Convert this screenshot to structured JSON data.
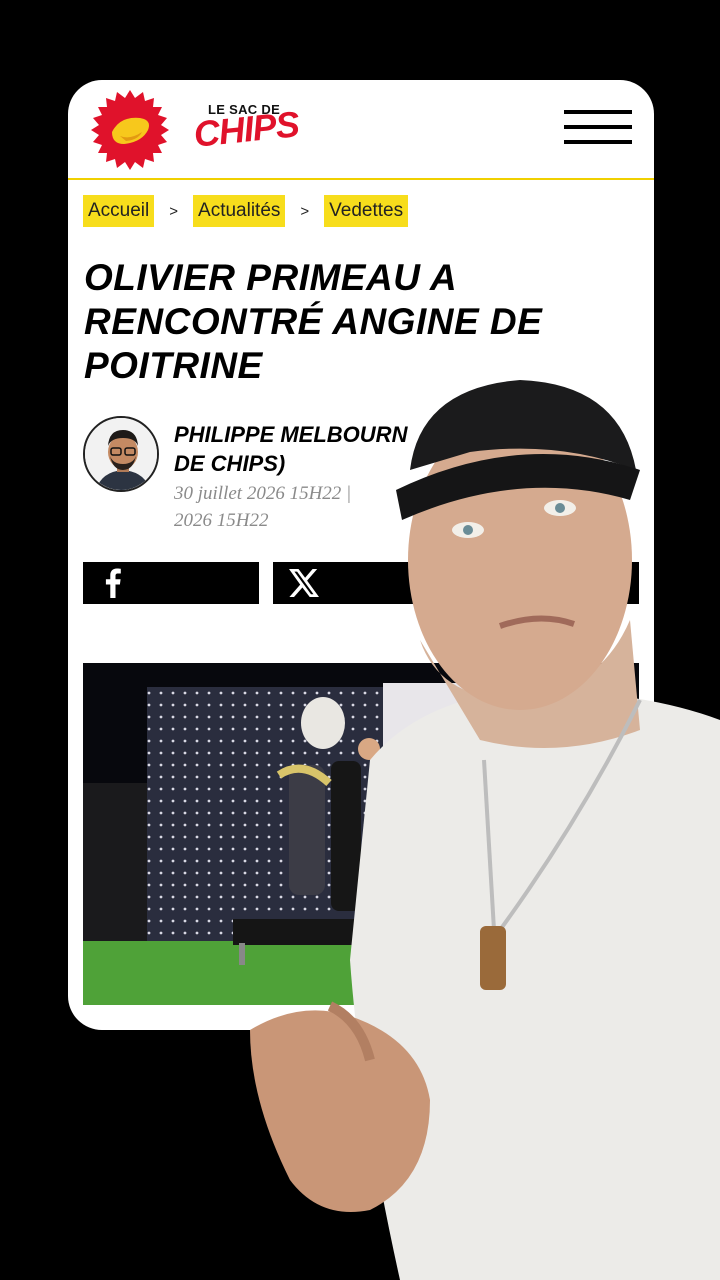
{
  "header": {
    "logo_small": "LE SAC DE",
    "logo_big": "CHIPS",
    "logo_icon": "chips-badge-icon",
    "menu_icon": "hamburger-menu-icon"
  },
  "breadcrumb": {
    "items": [
      "Accueil",
      "Actualités",
      "Vedettes"
    ],
    "separator": ">"
  },
  "article": {
    "title": "OLIVIER PRIMEAU A RENCONTRÉ ANGINE DE POITRINE",
    "author": "PHILIPPE MELBOURN",
    "author_suffix": "DE CHIPS)",
    "date_line1": "30 juillet 2026 15H22  |",
    "date_line2": "2026 15H22"
  },
  "share": {
    "facebook_icon": "facebook-icon",
    "x_icon": "x-icon"
  },
  "colors": {
    "accent_yellow": "#f7dd1c",
    "brand_red": "#e0122b",
    "text": "#000000",
    "meta_gray": "#8a8a8a"
  }
}
